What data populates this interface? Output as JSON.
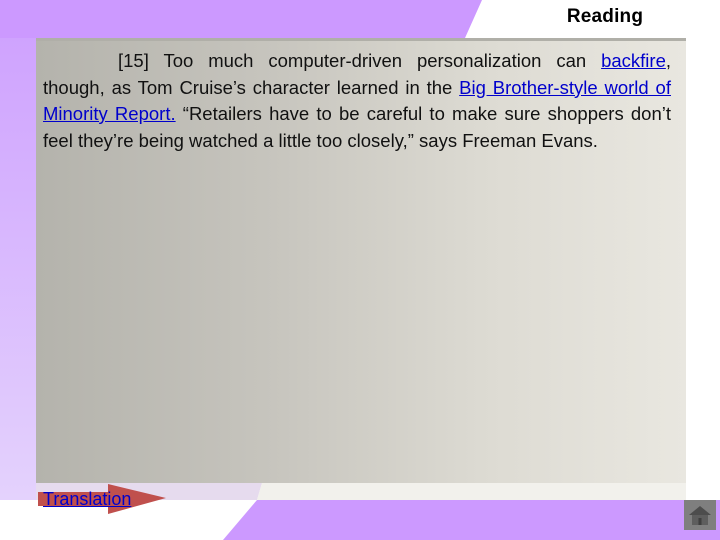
{
  "header": {
    "title": "Reading"
  },
  "passage": {
    "paragraph_number": "[15]",
    "segments": [
      {
        "text": "Too much computer-driven personalization can ",
        "link": false
      },
      {
        "text": "backfire",
        "link": true
      },
      {
        "text": ", though, as Tom Cruise’s character learned in the ",
        "link": false
      },
      {
        "text": "Big Brother-style world of Minority Report.",
        "link": true
      },
      {
        "text": " “Retailers have to be careful to make sure shoppers don’t feel they’re being watched a little too closely,” says Freeman Evans.",
        "link": false
      }
    ]
  },
  "footer": {
    "translation_label": "Translation",
    "home_icon": "home-icon"
  },
  "colors": {
    "accent_purple": "#cc99ff",
    "link_blue": "#0000cc",
    "arrow_red": "#c0504d",
    "home_button_gray": "#7f7f7f"
  }
}
